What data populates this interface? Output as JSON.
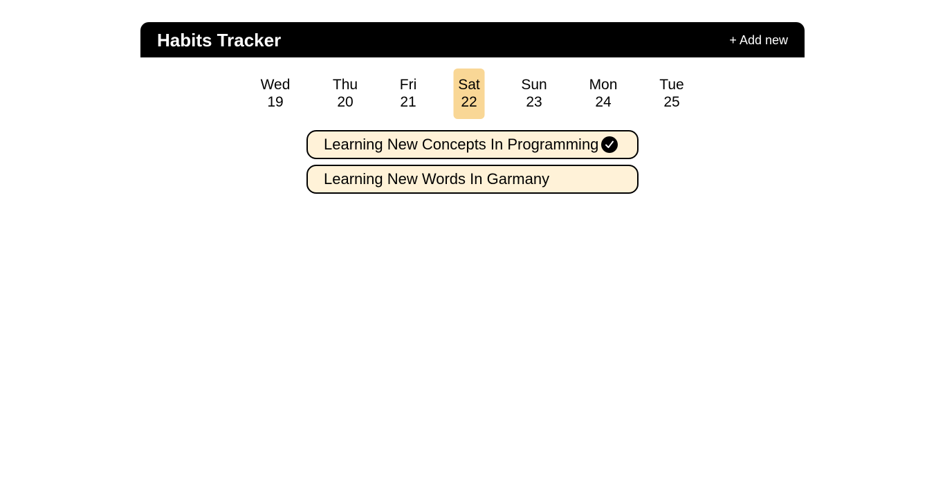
{
  "header": {
    "title": "Habits Tracker",
    "add_new_label": "+ Add new"
  },
  "days": [
    {
      "weekday": "Wed",
      "date": "19",
      "selected": false
    },
    {
      "weekday": "Thu",
      "date": "20",
      "selected": false
    },
    {
      "weekday": "Fri",
      "date": "21",
      "selected": false
    },
    {
      "weekday": "Sat",
      "date": "22",
      "selected": true
    },
    {
      "weekday": "Sun",
      "date": "23",
      "selected": false
    },
    {
      "weekday": "Mon",
      "date": "24",
      "selected": false
    },
    {
      "weekday": "Tue",
      "date": "25",
      "selected": false
    }
  ],
  "habits": [
    {
      "label": "Learning New Concepts In Programming",
      "done": true
    },
    {
      "label": "Learning New Words In Garmany",
      "done": false
    }
  ],
  "colors": {
    "header_bg": "#000000",
    "selected_day_bg": "#f9d796",
    "habit_bg": "#fff2d8",
    "habit_border": "#000000"
  },
  "icons": {
    "done": "check-circle-icon"
  }
}
